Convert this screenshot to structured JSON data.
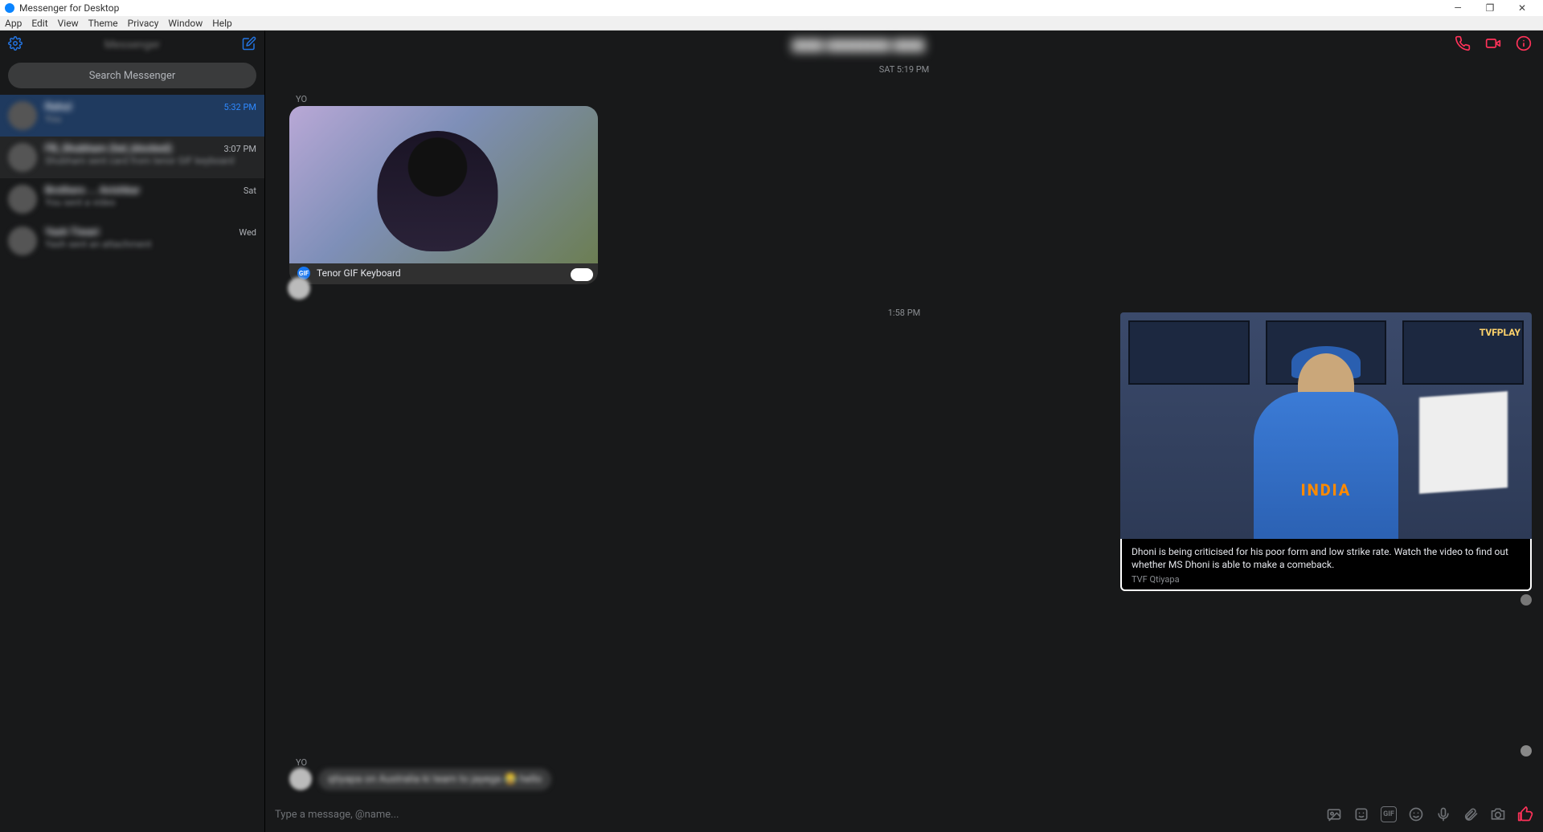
{
  "window": {
    "title": "Messenger for Desktop",
    "controls": {
      "min": "—",
      "max": "❐",
      "close": "✕"
    }
  },
  "menus": [
    "App",
    "Edit",
    "View",
    "Theme",
    "Privacy",
    "Window",
    "Help"
  ],
  "sidebar": {
    "title": "Messenger",
    "search_placeholder": "Search Messenger",
    "conversations": [
      {
        "name": "Rahul",
        "preview": "You",
        "time": "5:32 PM",
        "selected": true
      },
      {
        "name": "FB_Shubham (hel_blocked)",
        "preview": "Shubham sent card from tenor GIF keyboard",
        "time": "3:07 PM",
        "selected": false
      },
      {
        "name": "Brothers ... Avishkar",
        "preview": "You sent a video",
        "time": "Sat",
        "selected": false
      },
      {
        "name": "Yash Tiwari",
        "preview": "Yash sent an attachment",
        "time": "Wed",
        "selected": false
      }
    ]
  },
  "chat": {
    "peer_name": "████ ████████ ████",
    "timestamps": {
      "t1": "SAT 5:19 PM",
      "t2": "1:58 PM"
    },
    "in1": {
      "sender_short": "YO",
      "gif_source": "Tenor GIF Keyboard"
    },
    "out1": {
      "brand": "TVFPLAY",
      "jersey": "INDIA",
      "desc": "Dhoni is being criticised for his poor form and low strike rate. Watch the video to find out whether MS Dhoni is able to make a comeback.",
      "source": "TVF Qtiyapa"
    },
    "in2": {
      "sender_short": "YO",
      "text": "qtiyapa on Australia ki team to jayega 😂 hello"
    },
    "compose_placeholder": "Type a message, @name..."
  },
  "icons": {
    "gif_label": "GIF"
  }
}
